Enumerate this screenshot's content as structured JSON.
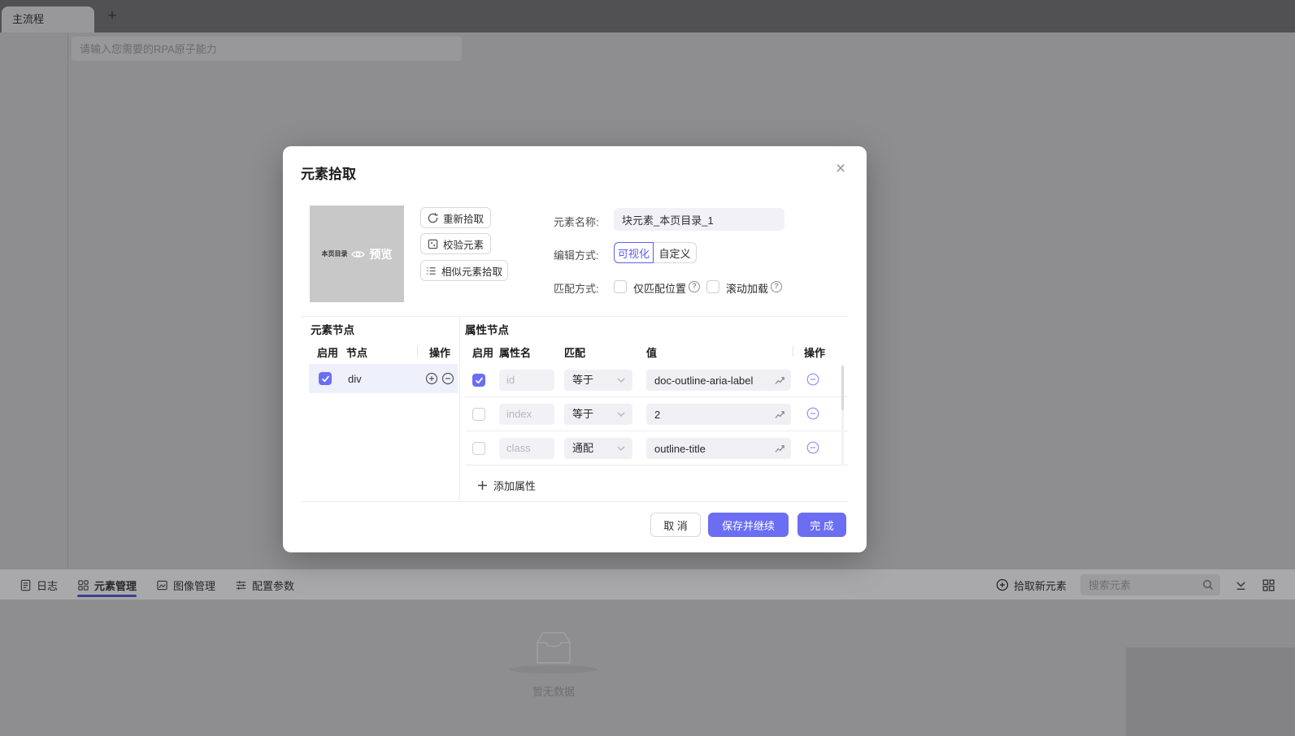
{
  "colors": {
    "accent": "#5d5ff0",
    "primary_button": "#6b6ef2",
    "checkbox_checked": "#6b6ef4",
    "selected_row": "#eef0fb",
    "active_tab_underline": "#3f3f8e"
  },
  "app": {
    "top": {
      "main_tab": "主流程",
      "add_tab": "+",
      "canvas_search_placeholder": "请输入您需要的RPA原子能力"
    },
    "bottom_bar": {
      "tabs": [
        {
          "label": "日志",
          "active": false
        },
        {
          "label": "元素管理",
          "active": true
        },
        {
          "label": "图像管理",
          "active": false
        },
        {
          "label": "配置参数",
          "active": false
        }
      ],
      "pick_new_element": "拾取新元素",
      "search_placeholder": "搜索元素",
      "empty_text": "暂无数据"
    }
  },
  "modal": {
    "title": "元素拾取",
    "close_icon": "×",
    "preview": {
      "thumb_text": "本页目录",
      "preview_label": "预览"
    },
    "actions": [
      {
        "label": "重新拾取",
        "icon": "refresh-icon"
      },
      {
        "label": "校验元素",
        "icon": "validate-icon"
      },
      {
        "label": "相似元素拾取",
        "icon": "similar-list-icon"
      }
    ],
    "form": {
      "name_label": "元素名称:",
      "name_value": "块元素_本页目录_1",
      "edit_mode_label": "编辑方式:",
      "edit_modes": [
        {
          "label": "可视化",
          "selected": true
        },
        {
          "label": "自定义",
          "selected": false
        }
      ],
      "match_label": "匹配方式:",
      "match_options": [
        {
          "label": "仅匹配位置",
          "checked": false,
          "help": "?"
        },
        {
          "label": "滚动加载",
          "checked": false,
          "help": "?"
        }
      ]
    },
    "element_nodes": {
      "title": "元素节点",
      "columns": [
        "启用",
        "节点",
        "操作"
      ],
      "rows": [
        {
          "enabled": true,
          "node": "div"
        }
      ]
    },
    "attribute_nodes": {
      "title": "属性节点",
      "columns": [
        "启用",
        "属性名",
        "匹配",
        "值",
        "操作"
      ],
      "rows": [
        {
          "enabled": true,
          "name": "id",
          "match": "等于",
          "value": "doc-outline-aria-label"
        },
        {
          "enabled": false,
          "name": "index",
          "match": "等于",
          "value": "2"
        },
        {
          "enabled": false,
          "name": "class",
          "match": "通配",
          "value": "outline-title"
        }
      ],
      "add_label": "添加属性"
    },
    "footer": {
      "cancel": "取 消",
      "save_continue": "保存并继续",
      "done": "完 成"
    }
  }
}
